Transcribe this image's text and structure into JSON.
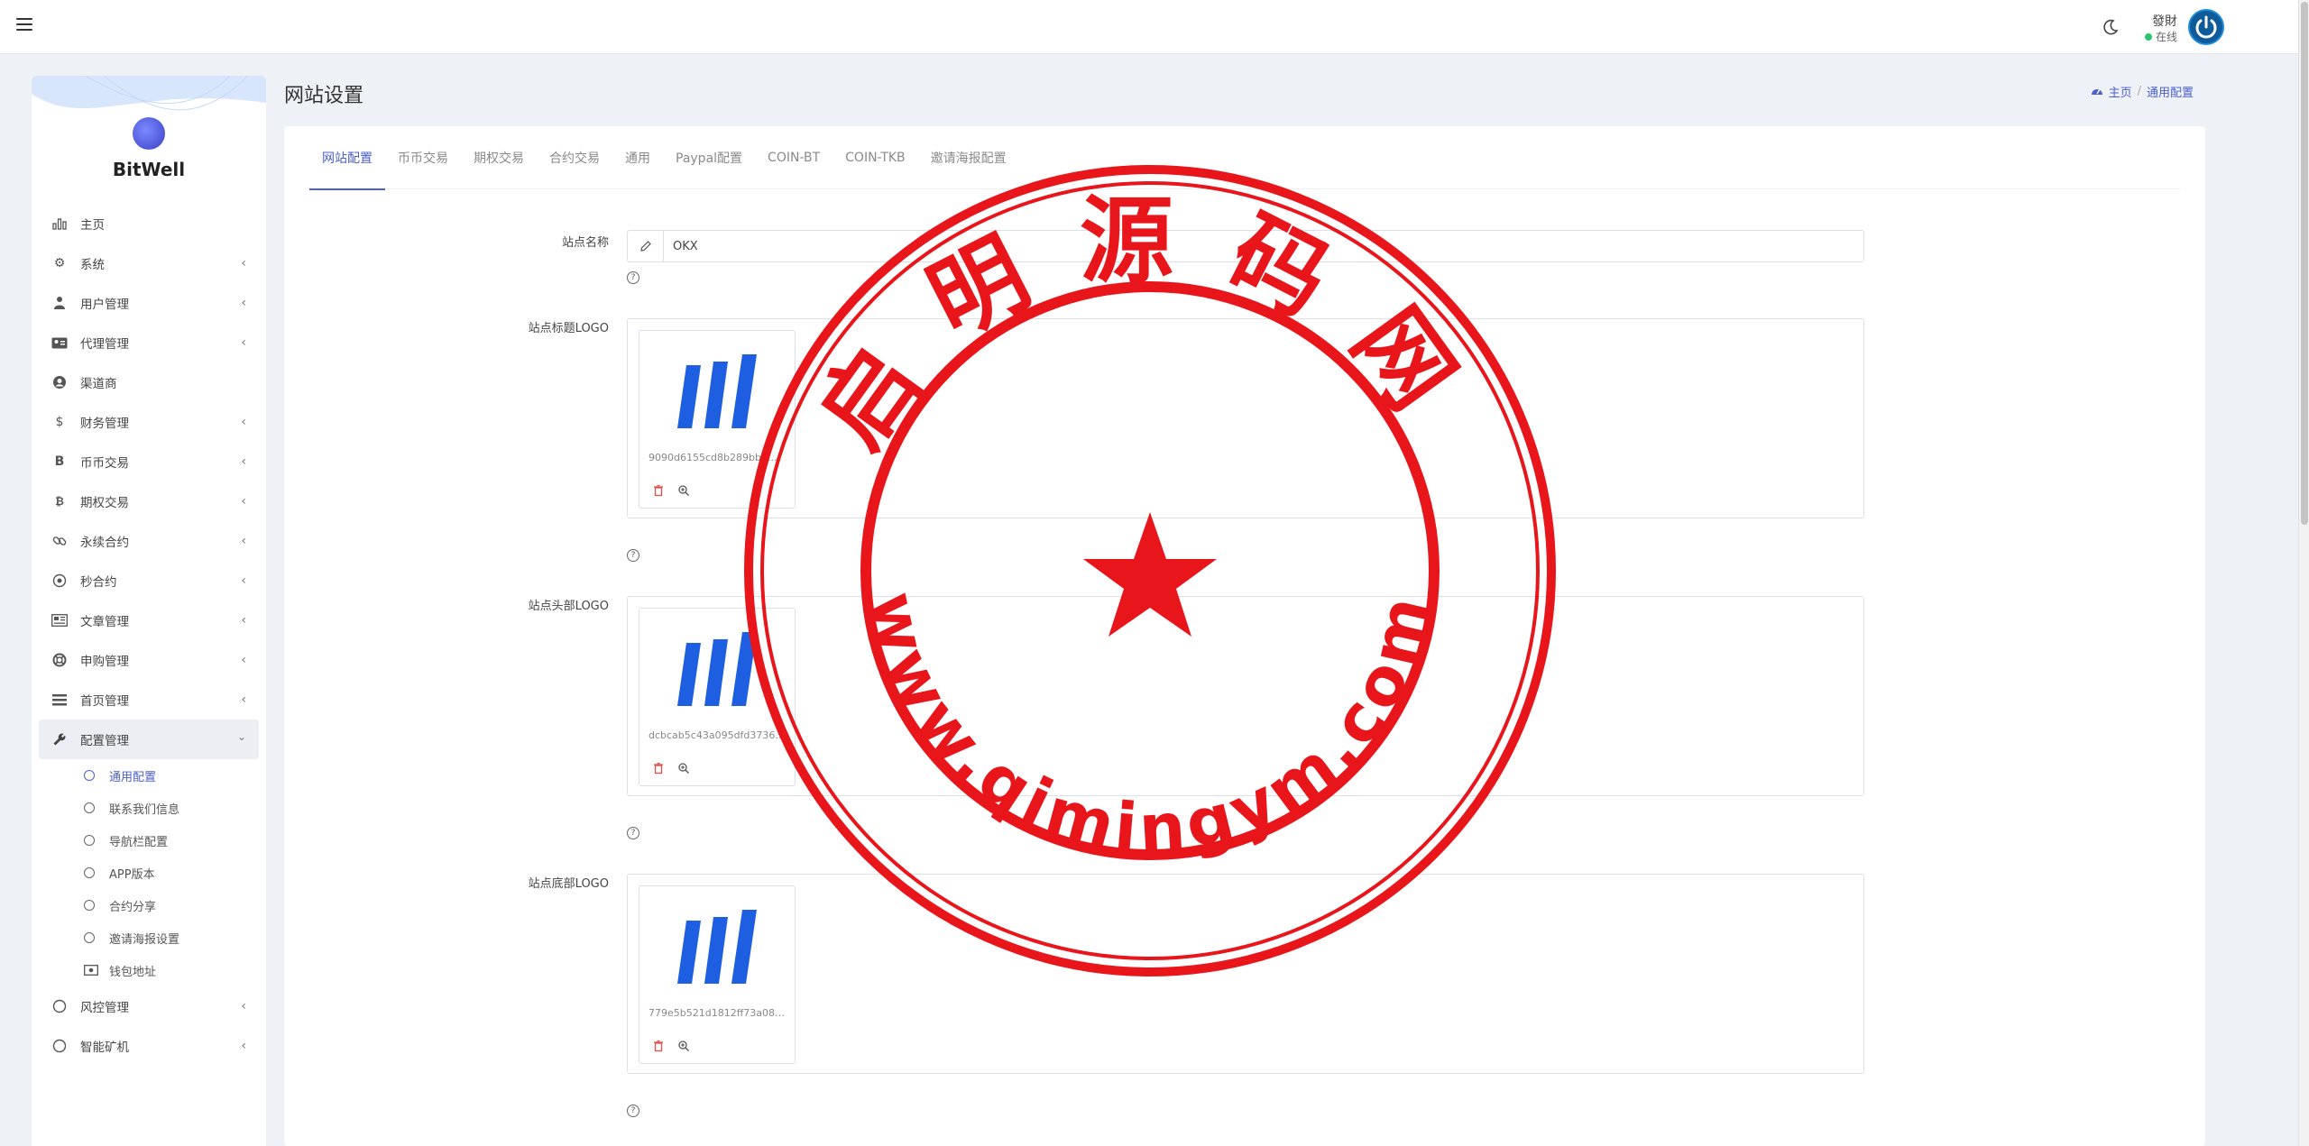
{
  "header": {
    "user_name": "發財",
    "user_status": "在线"
  },
  "sidebar": {
    "brand": "BitWell",
    "items": [
      {
        "label": "主页",
        "icon": "bar-chart-icon"
      },
      {
        "label": "系统",
        "icon": "gear-icon"
      },
      {
        "label": "用户管理",
        "icon": "user-tie-icon"
      },
      {
        "label": "代理管理",
        "icon": "id-card-icon"
      },
      {
        "label": "渠道商",
        "icon": "user-circle-icon"
      },
      {
        "label": "财务管理",
        "icon": "dollar-icon"
      },
      {
        "label": "币币交易",
        "icon": "bitcoin-b-icon"
      },
      {
        "label": "期权交易",
        "icon": "bitcoin-icon"
      },
      {
        "label": "永续合约",
        "icon": "link-icon"
      },
      {
        "label": "秒合约",
        "icon": "dot-circle-icon"
      },
      {
        "label": "文章管理",
        "icon": "newspaper-icon"
      },
      {
        "label": "申购管理",
        "icon": "life-ring-icon"
      },
      {
        "label": "首页管理",
        "icon": "list-icon"
      },
      {
        "label": "配置管理",
        "icon": "wrench-icon"
      }
    ],
    "sub_items": [
      "通用配置",
      "联系我们信息",
      "导航栏配置",
      "APP版本",
      "合约分享",
      "邀请海报设置",
      "钱包地址"
    ],
    "bottom_items": [
      {
        "label": "风控管理"
      },
      {
        "label": "智能矿机"
      }
    ]
  },
  "page": {
    "title": "网站设置",
    "breadcrumb_home": "主页",
    "breadcrumb_current": "通用配置"
  },
  "tabs": [
    "网站配置",
    "币币交易",
    "期权交易",
    "合约交易",
    "通用",
    "Paypal配置",
    "COIN-BT",
    "COIN-TKB",
    "邀请海报配置"
  ],
  "form": {
    "site_name_label": "站点名称",
    "site_name_value": "OKX",
    "title_logo_label": "站点标题LOGO",
    "title_logo_file": "9090d6155cd8b289bb9...",
    "head_logo_label": "站点头部LOGO",
    "head_logo_file": "dcbcab5c43a095dfd37364...",
    "foot_logo_label": "站点底部LOGO",
    "foot_logo_file": "779e5b521d1812ff73a08de..."
  },
  "watermark": {
    "top_text": "启明源码网",
    "bottom_text": "www.qimingym.com",
    "color": "#e8151b"
  }
}
